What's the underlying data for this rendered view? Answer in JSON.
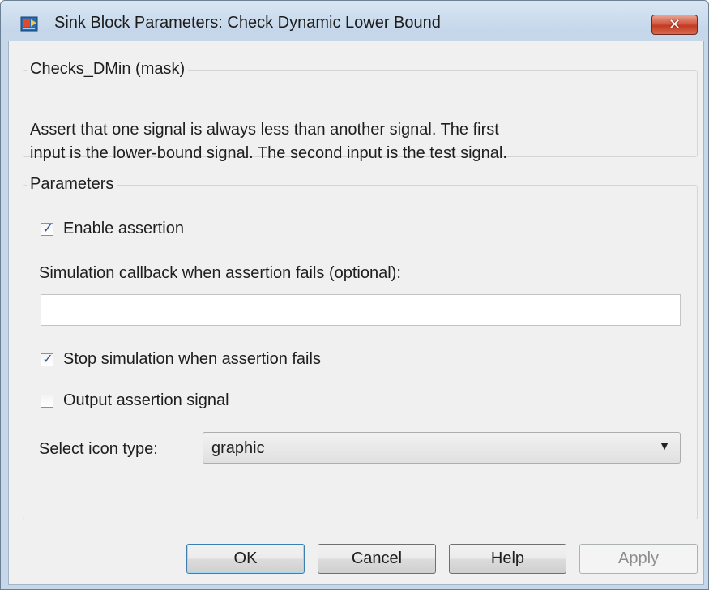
{
  "window": {
    "title": "Sink Block Parameters: Check Dynamic Lower Bound",
    "close_label": "✕"
  },
  "mask": {
    "legend": "Checks_DMin (mask)",
    "description_line1": "Assert that one signal is always less than another signal.  The first",
    "description_line2": "input is the lower-bound signal.  The second input is the test signal."
  },
  "parameters": {
    "legend": "Parameters",
    "enable_assertion": {
      "label": "Enable assertion",
      "checked": true
    },
    "callback_label": "Simulation callback when assertion fails (optional):",
    "callback_value": "",
    "stop_simulation": {
      "label": "Stop simulation when assertion fails",
      "checked": true
    },
    "output_signal": {
      "label": "Output assertion signal",
      "checked": false
    },
    "icon_type_label": "Select icon type:",
    "icon_type_value": "graphic"
  },
  "buttons": {
    "ok": "OK",
    "cancel": "Cancel",
    "help": "Help",
    "apply": "Apply"
  }
}
